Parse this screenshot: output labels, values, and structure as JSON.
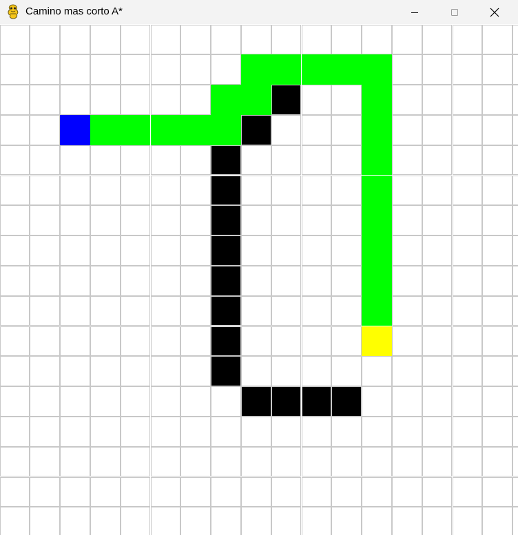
{
  "window": {
    "title": "Camino mas corto A*",
    "app_icon": "pygame-snake-icon",
    "controls": {
      "minimize_icon": "minimize-icon",
      "maximize_icon": "maximize-icon",
      "close_icon": "close-icon"
    }
  },
  "grid": {
    "columns": 18,
    "rows": 17,
    "colors": {
      "empty": "#ffffff",
      "grid_line": "#c8c8c8",
      "wall": "#000000",
      "path": "#00ff00",
      "start": "#0000ff",
      "end": "#ffff00"
    },
    "start": [
      2,
      3
    ],
    "end": [
      12,
      10
    ],
    "walls": [
      [
        9,
        2
      ],
      [
        8,
        3
      ],
      [
        7,
        4
      ],
      [
        7,
        5
      ],
      [
        7,
        6
      ],
      [
        7,
        7
      ],
      [
        7,
        8
      ],
      [
        7,
        9
      ],
      [
        7,
        10
      ],
      [
        7,
        11
      ],
      [
        8,
        12
      ],
      [
        9,
        12
      ],
      [
        10,
        12
      ],
      [
        11,
        12
      ]
    ],
    "path": [
      [
        3,
        3
      ],
      [
        4,
        3
      ],
      [
        5,
        3
      ],
      [
        6,
        3
      ],
      [
        7,
        3
      ],
      [
        7,
        2
      ],
      [
        8,
        2
      ],
      [
        8,
        1
      ],
      [
        9,
        1
      ],
      [
        10,
        1
      ],
      [
        11,
        1
      ],
      [
        12,
        1
      ],
      [
        12,
        2
      ],
      [
        12,
        3
      ],
      [
        12,
        4
      ],
      [
        12,
        5
      ],
      [
        12,
        6
      ],
      [
        12,
        7
      ],
      [
        12,
        8
      ],
      [
        12,
        9
      ]
    ]
  }
}
